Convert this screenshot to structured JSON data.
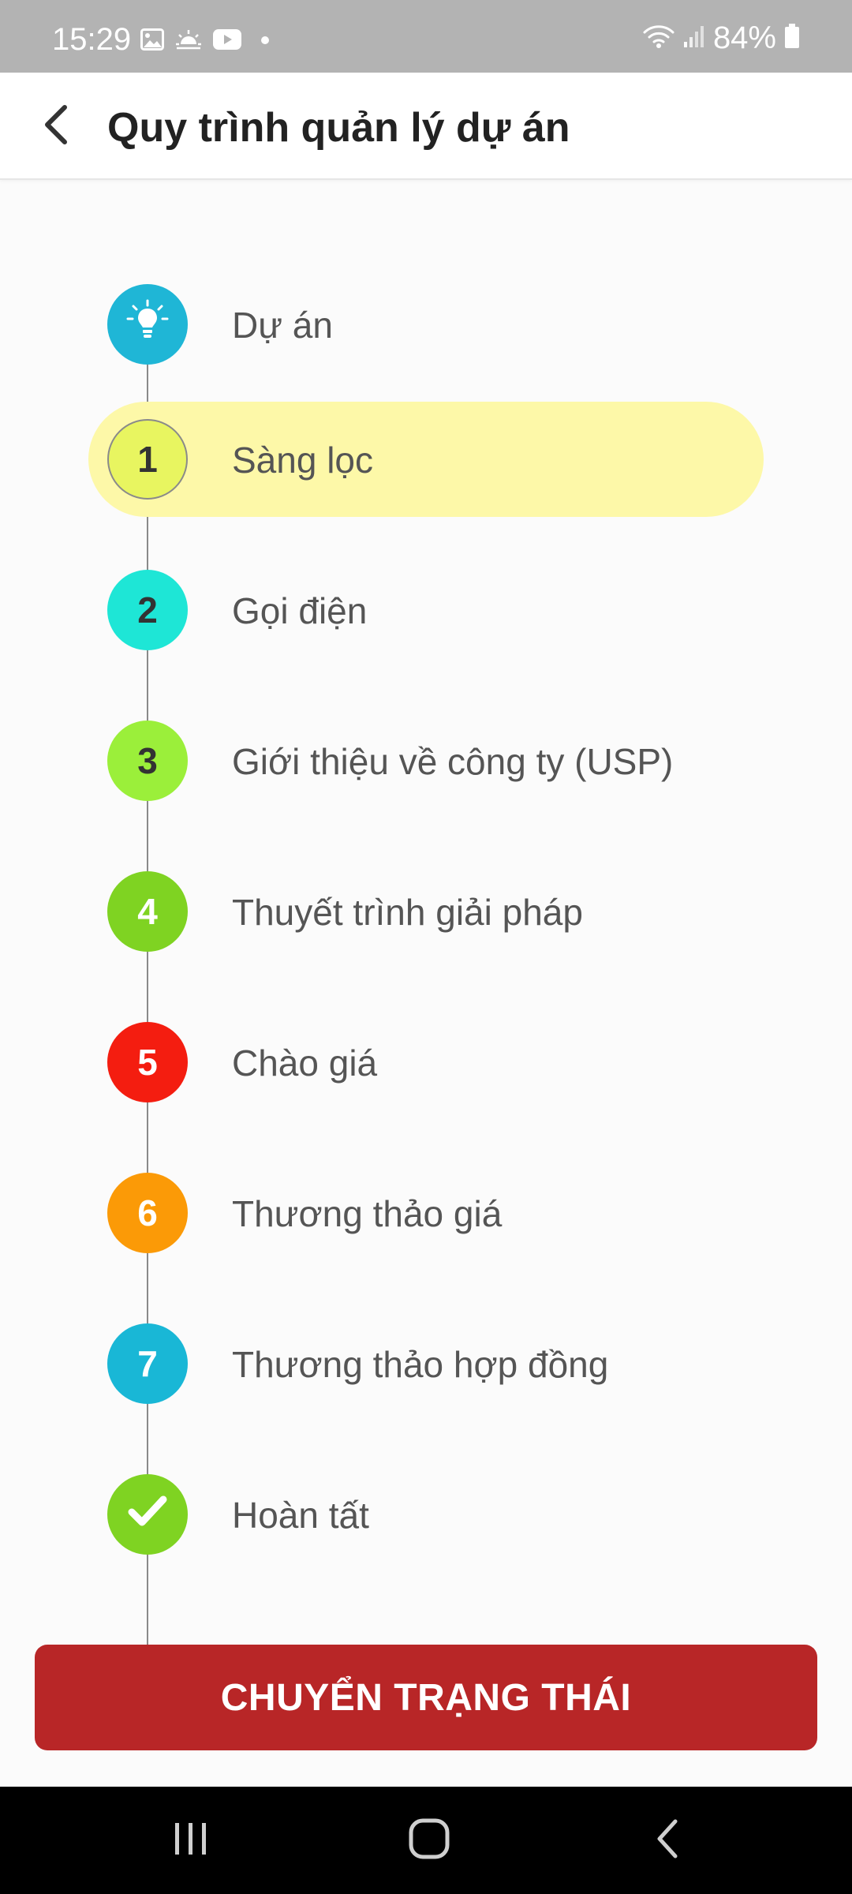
{
  "status_bar": {
    "time": "15:29",
    "battery": "84%",
    "icons": [
      "image-icon",
      "weather-icon",
      "youtube-icon",
      "dot-icon",
      "wifi-icon",
      "signal-icon",
      "battery-icon"
    ]
  },
  "app_bar": {
    "title": "Quy trình quản lý dự án",
    "back_icon": "chevron-left-icon"
  },
  "steps": [
    {
      "marker": "",
      "icon": "lightbulb-icon",
      "label": "Dự án",
      "color": "#1fb6d6",
      "active": false
    },
    {
      "marker": "1",
      "label": "Sàng lọc",
      "color": "#e8f560",
      "active": true
    },
    {
      "marker": "2",
      "label": "Gọi điện",
      "color": "#1ee6d6",
      "active": false
    },
    {
      "marker": "3",
      "label": "Giới thiệu về công ty (USP)",
      "color": "#9bef3a",
      "active": false
    },
    {
      "marker": "4",
      "label": "Thuyết trình giải pháp",
      "color": "#7fd322",
      "active": false
    },
    {
      "marker": "5",
      "label": "Chào giá",
      "color": "#f41d10",
      "active": false
    },
    {
      "marker": "6",
      "label": "Thương thảo giá",
      "color": "#fb9a07",
      "active": false
    },
    {
      "marker": "7",
      "label": "Thương thảo hợp đồng",
      "color": "#19b7d6",
      "active": false
    },
    {
      "marker": "",
      "icon": "checkmark-icon",
      "label": "Hoàn tất",
      "color": "#7fd322",
      "active": false
    }
  ],
  "colors": {
    "highlight": "#fdf8a8",
    "button": "#b82627"
  },
  "action_button": {
    "label": "CHUYỂN TRẠNG THÁI"
  },
  "nav_bar": {
    "recents_icon": "recents-icon",
    "home_icon": "home-icon",
    "back_icon": "back-icon"
  }
}
